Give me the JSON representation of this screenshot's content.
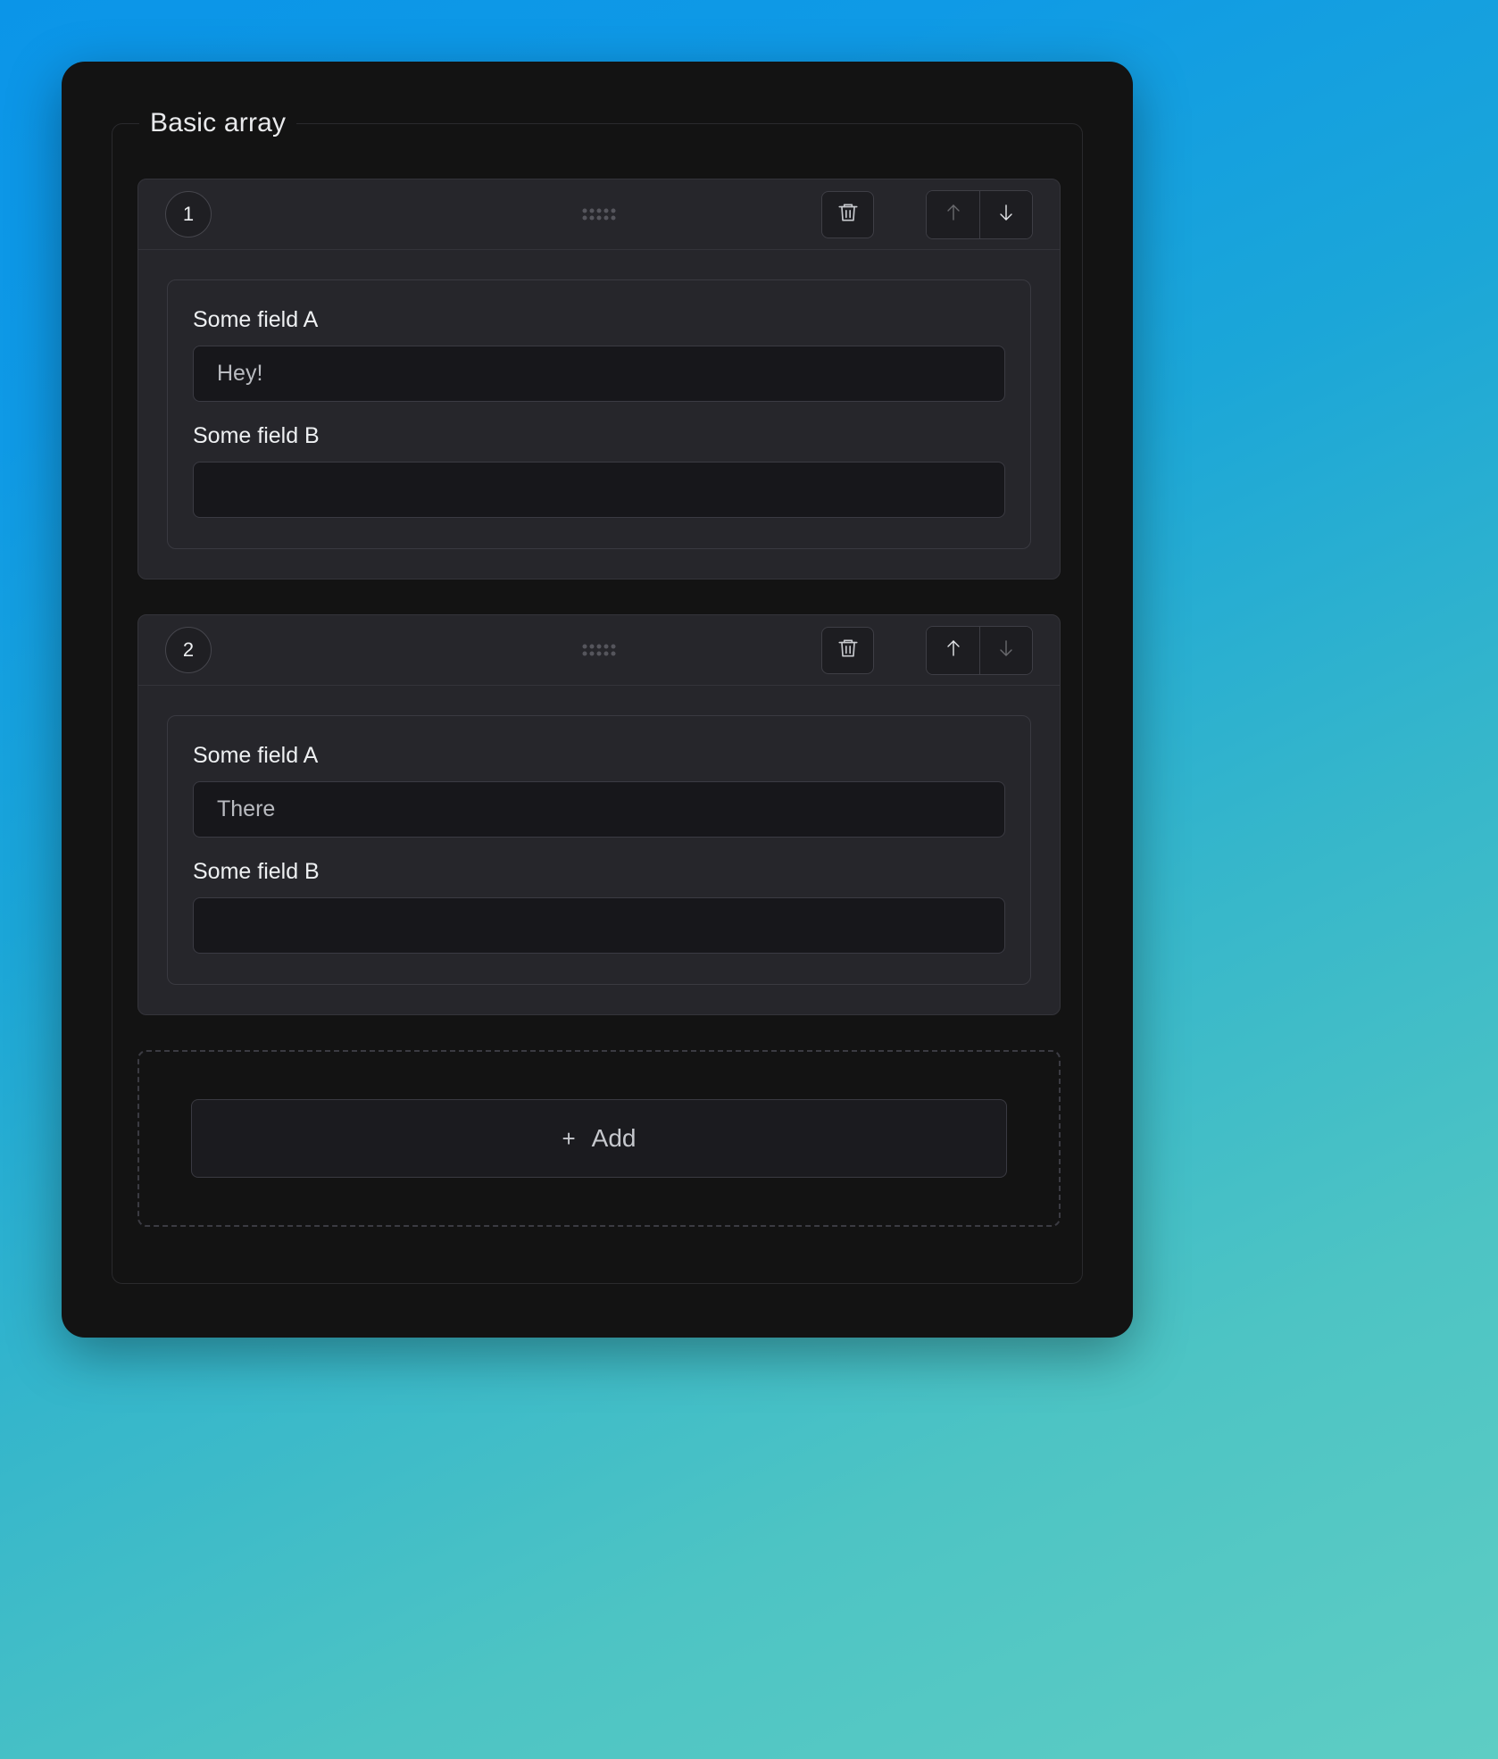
{
  "theme": {
    "background_gradient_from": "#0b95e8",
    "background_gradient_to": "#5ecdc4",
    "panel_bg": "#131313",
    "card_bg": "#26262b",
    "input_bg": "#17171b",
    "border": "#34343a",
    "text": "#e9eaec",
    "muted_text": "#b9bbc0"
  },
  "fieldset": {
    "legend": "Basic array"
  },
  "items": [
    {
      "index_label": "1",
      "drag_handle_icon": "drag-dots-icon",
      "delete_icon": "trash-icon",
      "move_up_icon": "arrow-up-icon",
      "move_down_icon": "arrow-down-icon",
      "move_up_enabled": false,
      "move_down_enabled": true,
      "fields": [
        {
          "label": "Some field A",
          "value": "Hey!",
          "placeholder": ""
        },
        {
          "label": "Some field B",
          "value": "",
          "placeholder": ""
        }
      ]
    },
    {
      "index_label": "2",
      "drag_handle_icon": "drag-dots-icon",
      "delete_icon": "trash-icon",
      "move_up_icon": "arrow-up-icon",
      "move_down_icon": "arrow-down-icon",
      "move_up_enabled": true,
      "move_down_enabled": false,
      "fields": [
        {
          "label": "Some field A",
          "value": "There",
          "placeholder": ""
        },
        {
          "label": "Some field B",
          "value": "",
          "placeholder": ""
        }
      ]
    }
  ],
  "add": {
    "label": "Add",
    "plus_glyph": "+",
    "icon": "plus-icon"
  }
}
